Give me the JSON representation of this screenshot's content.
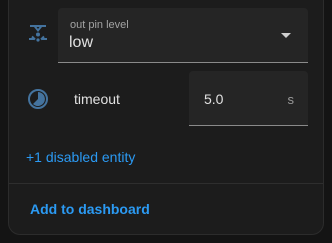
{
  "select": {
    "label": "out pin level",
    "value": "low",
    "icon": "tune-vertical-icon"
  },
  "number": {
    "label": "timeout",
    "value": "5.0",
    "unit": "s",
    "icon": "timer-icon"
  },
  "links": {
    "disabled_entities": "+1 disabled entity",
    "add_to_dashboard": "Add to dashboard"
  },
  "colors": {
    "accent": "#2b9af3",
    "icon": "#44739e"
  }
}
